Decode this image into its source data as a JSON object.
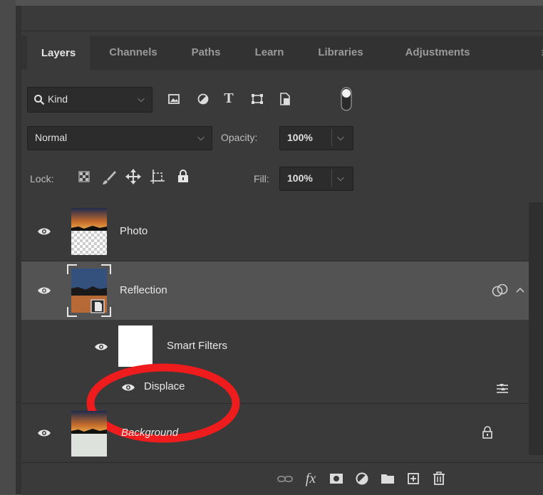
{
  "tabs": [
    "Layers",
    "Channels",
    "Paths",
    "Learn",
    "Libraries",
    "Adjustments"
  ],
  "filter": {
    "kind_label": "Kind"
  },
  "blend": {
    "mode": "Normal",
    "opacity_label": "Opacity:",
    "opacity_value": "100%"
  },
  "lock": {
    "label": "Lock:",
    "fill_label": "Fill:",
    "fill_value": "100%"
  },
  "layers": {
    "photo": "Photo",
    "reflection": "Reflection",
    "smart_filters": "Smart Filters",
    "displace": "Displace",
    "background": "Background"
  },
  "colors": {
    "panel": "#3a3a3a",
    "selected_row": "#535353",
    "annotation": "#ee1c1c"
  }
}
